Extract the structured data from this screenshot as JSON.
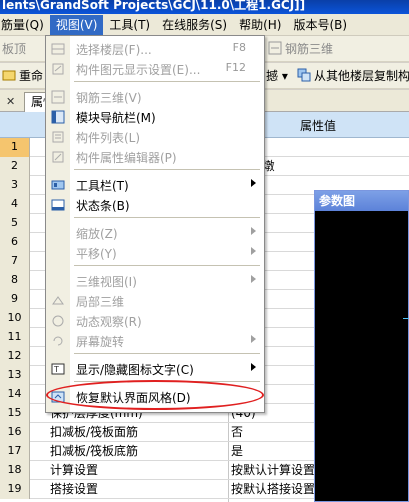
{
  "title": "lents\\GrandSoft Projects\\GCJ\\11.0\\工程1.GCJ]]",
  "menubar": [
    "筋量(Q)",
    "视图(V)",
    "工具(T)",
    "在线服务(S)",
    "帮助(H)",
    "版本号(B)"
  ],
  "toolbar1": {
    "left": "板顶",
    "right": "钢筋三维"
  },
  "toolbar2": {
    "left": "重命",
    "drop": "撼",
    "copy": "从其他楼层复制构"
  },
  "panel": {
    "tab": "属性",
    "header_value": "属性值"
  },
  "rows": [
    {
      "num": "1",
      "name": "",
      "value": ""
    },
    {
      "num": "2",
      "name": "",
      "value": "5下柱墩"
    },
    {
      "num": "3",
      "name": "",
      "value": ""
    },
    {
      "num": "4",
      "name": "",
      "value": ""
    },
    {
      "num": "5",
      "name": "",
      "value": ""
    },
    {
      "num": "6",
      "name": "",
      "value": ""
    },
    {
      "num": "7",
      "name": "",
      "value": ""
    },
    {
      "num": "8",
      "name": "",
      "value": "00"
    },
    {
      "num": "9",
      "name": "",
      "value": "00"
    },
    {
      "num": "10",
      "name": "",
      "value": ""
    },
    {
      "num": "11",
      "name": "",
      "value": ""
    },
    {
      "num": "12",
      "name": "",
      "value": ""
    },
    {
      "num": "13",
      "name": "",
      "value": ""
    },
    {
      "num": "14",
      "name": "",
      "value": ""
    },
    {
      "num": "15",
      "name": "保护层厚度(mm)",
      "value": "(40)"
    },
    {
      "num": "16",
      "name": "扣减板/筏板面筋",
      "value": "否"
    },
    {
      "num": "17",
      "name": "扣减板/筏板底筋",
      "value": "是"
    },
    {
      "num": "18",
      "name": "计算设置",
      "value": "按默认计算设置"
    },
    {
      "num": "19",
      "name": "搭接设置",
      "value": "按默认搭接设置"
    }
  ],
  "diagram": {
    "title": "参数图"
  },
  "menu": {
    "items": [
      {
        "label": "选择楼层(F)...",
        "key": "F8",
        "enabled": false,
        "icon": "floor-select-icon"
      },
      {
        "label": "构件图元显示设置(E)...",
        "key": "F12",
        "enabled": false,
        "icon": "display-settings-icon"
      },
      {
        "label": "钢筋三维(V)",
        "key": "",
        "enabled": false,
        "icon": "rebar-3d-icon"
      },
      {
        "label": "模块导航栏(M)",
        "key": "",
        "enabled": true,
        "icon": "nav-bar-icon"
      },
      {
        "label": "构件列表(L)",
        "key": "",
        "enabled": false,
        "icon": "component-list-icon"
      },
      {
        "label": "构件属性编辑器(P)",
        "key": "",
        "enabled": false,
        "icon": "property-editor-icon"
      },
      {
        "label": "工具栏(T)",
        "key": "",
        "enabled": true,
        "icon": "toolbar-icon",
        "submenu": true
      },
      {
        "label": "状态条(B)",
        "key": "",
        "enabled": true,
        "icon": "statusbar-icon"
      },
      {
        "label": "缩放(Z)",
        "key": "",
        "enabled": false,
        "icon": "",
        "submenu": true
      },
      {
        "label": "平移(Y)",
        "key": "",
        "enabled": false,
        "icon": "",
        "submenu": true
      },
      {
        "label": "三维视图(I)",
        "key": "",
        "enabled": false,
        "icon": "",
        "submenu": true
      },
      {
        "label": "局部三维",
        "key": "",
        "enabled": false,
        "icon": "partial-3d-icon"
      },
      {
        "label": "动态观察(R)",
        "key": "",
        "enabled": false,
        "icon": "orbit-icon"
      },
      {
        "label": "屏幕旋转",
        "key": "",
        "enabled": false,
        "icon": "screen-rotate-icon",
        "submenu": true
      },
      {
        "label": "显示/隐藏图标文字(C)",
        "key": "",
        "enabled": true,
        "icon": "icon-text-icon",
        "submenu": true
      },
      {
        "label": "恢复默认界面风格(D)",
        "key": "",
        "enabled": true,
        "icon": "restore-layout-icon"
      }
    ]
  }
}
